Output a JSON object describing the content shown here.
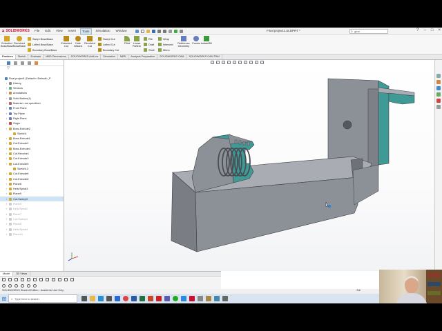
{
  "app": {
    "brand": "SOLIDWORKS",
    "document_title": "Final project1.SLDPRT *",
    "search_placeholder": "gear",
    "menus": [
      "File",
      "Edit",
      "View",
      "Insert",
      "Tools",
      "Simulation",
      "Window"
    ],
    "active_menu": "Tools"
  },
  "commands": {
    "extruded_boss": "Extruded Boss/Base",
    "revolved_boss": "Revolved Boss/Base",
    "swept_boss": "Swept Boss/Base",
    "lofted_boss": "Lofted Boss/Base",
    "boundary_boss": "Boundary Boss/Base",
    "extruded_cut": "Extruded Cut",
    "hole_wizard": "Hole Wizard",
    "revolved_cut": "Revolved Cut",
    "swept_cut": "Swept Cut",
    "lofted_cut": "Lofted Cut",
    "boundary_cut": "Boundary Cut",
    "fillet": "Fillet",
    "linear_pattern": "Linear Pattern",
    "rib": "Rib",
    "draft": "Draft",
    "shell": "Shell",
    "wrap": "Wrap",
    "intersect": "Intersect",
    "mirror": "Mirror",
    "reference_geometry": "Reference Geometry",
    "curves": "Curves",
    "instant3d": "Instant3D"
  },
  "command_tabs": [
    "Features",
    "Sketch",
    "Evaluate",
    "MBD Dimensions",
    "SOLIDWORKS Add-Ins",
    "Simulation",
    "MBD",
    "Analysis Preparation",
    "SOLIDWORKS CAM",
    "SOLIDWORKS CAM TBM"
  ],
  "active_command_tab": "Features",
  "feature_tree": [
    {
      "label": "Final project1 (Default<<Default>_P",
      "state": "normal",
      "depth": 0
    },
    {
      "label": "History",
      "state": "normal",
      "depth": 1
    },
    {
      "label": "Sensors",
      "state": "normal",
      "depth": 1
    },
    {
      "label": "Annotations",
      "state": "normal",
      "depth": 1
    },
    {
      "label": "Solid Bodies(1)",
      "state": "normal",
      "depth": 1
    },
    {
      "label": "Material <not specified>",
      "state": "normal",
      "depth": 1
    },
    {
      "label": "Front Plane",
      "state": "normal",
      "depth": 1
    },
    {
      "label": "Top Plane",
      "state": "normal",
      "depth": 1
    },
    {
      "label": "Right Plane",
      "state": "normal",
      "depth": 1
    },
    {
      "label": "Origin",
      "state": "normal",
      "depth": 1
    },
    {
      "label": "Boss-Extrude2",
      "state": "normal",
      "depth": 1
    },
    {
      "label": "Sketch1",
      "state": "normal",
      "depth": 2
    },
    {
      "label": "Boss-Extrude1",
      "state": "normal",
      "depth": 1
    },
    {
      "label": "Cut-Extrude2",
      "state": "normal",
      "depth": 1
    },
    {
      "label": "Boss-Extrude4",
      "state": "normal",
      "depth": 1
    },
    {
      "label": "Cut-Revolve1",
      "state": "normal",
      "depth": 1
    },
    {
      "label": "Cut-Extrude3",
      "state": "normal",
      "depth": 1
    },
    {
      "label": "Cut-Extrude5",
      "state": "normal",
      "depth": 1
    },
    {
      "label": "Sketch13",
      "state": "normal",
      "depth": 2
    },
    {
      "label": "Cut-Extrude6",
      "state": "normal",
      "depth": 1
    },
    {
      "label": "Cut-Extrude8",
      "state": "normal",
      "depth": 1
    },
    {
      "label": "Plane8",
      "state": "normal",
      "depth": 1
    },
    {
      "label": "Helix/Spiral3",
      "state": "normal",
      "depth": 1
    },
    {
      "label": "Plane9",
      "state": "normal",
      "depth": 1
    },
    {
      "label": "Cut-Sweep3",
      "state": "selected",
      "depth": 1
    },
    {
      "label": "Plane5",
      "state": "grey",
      "depth": 1
    },
    {
      "label": "Helix/Spiral2",
      "state": "grey",
      "depth": 1
    },
    {
      "label": "Plane7",
      "state": "grey",
      "depth": 1
    },
    {
      "label": "Cut-Sweep4",
      "state": "grey",
      "depth": 1
    },
    {
      "label": "Plane6",
      "state": "grey",
      "depth": 1
    },
    {
      "label": "Helix/Spiral4",
      "state": "grey",
      "depth": 1
    },
    {
      "label": "Plane10",
      "state": "grey",
      "depth": 1
    }
  ],
  "bottom_tabs": [
    "Model",
    "3D Views"
  ],
  "active_bottom_tab": "Model",
  "status": {
    "left": "SOLIDWORKS Student Edition - Academic Use Only",
    "right": "Edi"
  },
  "taskbar": {
    "search_placeholder": "Type here to search"
  },
  "colors": {
    "model_face": "#8c9097",
    "model_dark": "#6e7278",
    "model_light": "#a9adb3",
    "cut_face": "#3f9a96",
    "edge": "#3b3e44",
    "brand": "#c8102e",
    "selection": "#cfe3f7"
  }
}
